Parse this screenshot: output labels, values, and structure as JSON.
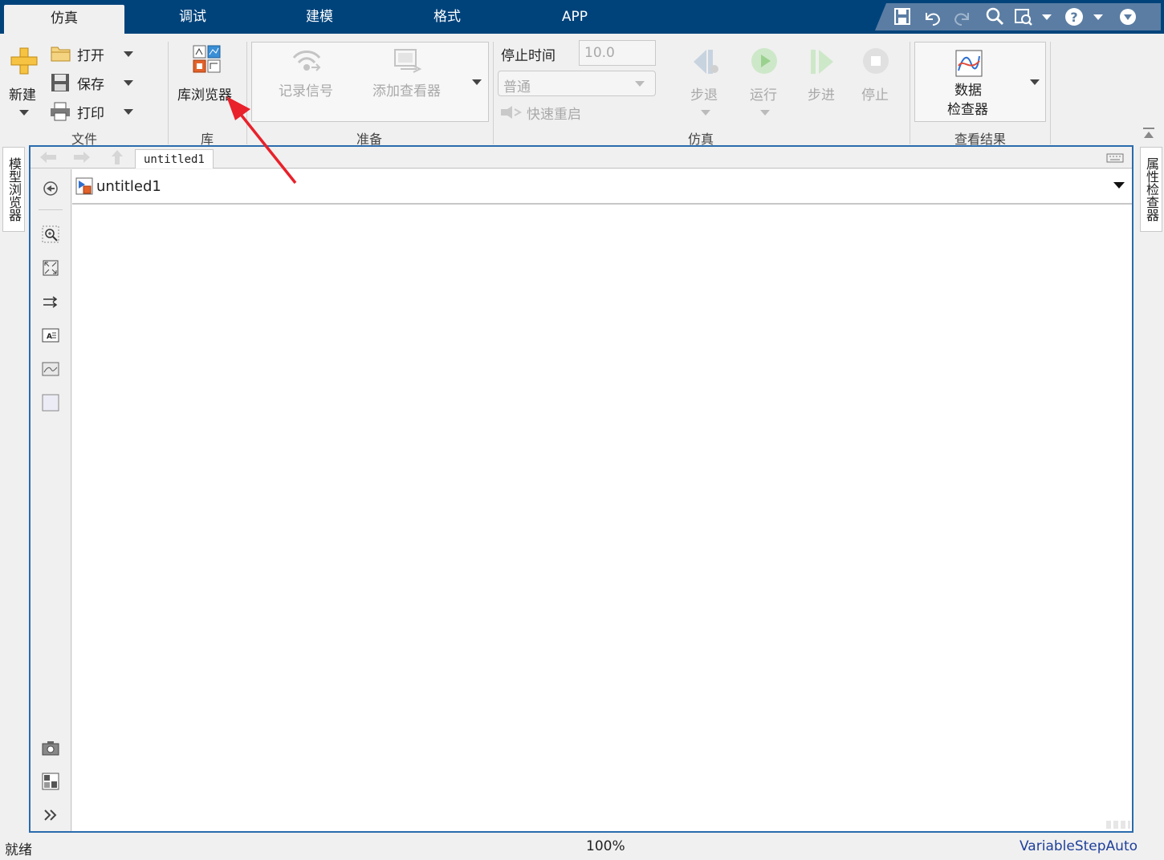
{
  "tabs": [
    "仿真",
    "调试",
    "建模",
    "格式",
    "APP"
  ],
  "quick_access": [
    "save-icon",
    "undo-icon",
    "redo-icon",
    "search-icon",
    "find-icon",
    "help-icon",
    "collapse-icon"
  ],
  "file_group": {
    "new_label": "新建",
    "open_label": "打开",
    "save_label": "保存",
    "print_label": "打印",
    "group_label": "文件"
  },
  "library_group": {
    "browser_label": "库浏览器",
    "group_label": "库"
  },
  "prepare_group": {
    "log_signals_label": "记录信号",
    "add_viewer_label": "添加查看器",
    "group_label": "准备"
  },
  "simulate_group": {
    "stop_time_label": "停止时间",
    "stop_time_value": "10.0",
    "mode_value": "普通",
    "fast_restart_label": "快速重启",
    "step_back_label": "步退",
    "run_label": "运行",
    "step_forward_label": "步进",
    "stop_label": "停止",
    "group_label": "仿真"
  },
  "results_group": {
    "inspector_line1": "数据",
    "inspector_line2": "检查器",
    "group_label": "查看结果"
  },
  "left_rail": {
    "model_browser_label": "模型浏览器"
  },
  "right_rail": {
    "property_inspector_label": "属性检查器"
  },
  "editor": {
    "breadcrumb": "untitled1",
    "address": "untitled1"
  },
  "statusbar": {
    "status": "就绪",
    "zoom": "100%",
    "solver": "VariableStepAuto"
  },
  "colors": {
    "title_bar": "#00437b",
    "selection_border": "#2a6bad",
    "annotation_arrow": "#e8212b",
    "solver_text": "#1f3f9a"
  }
}
